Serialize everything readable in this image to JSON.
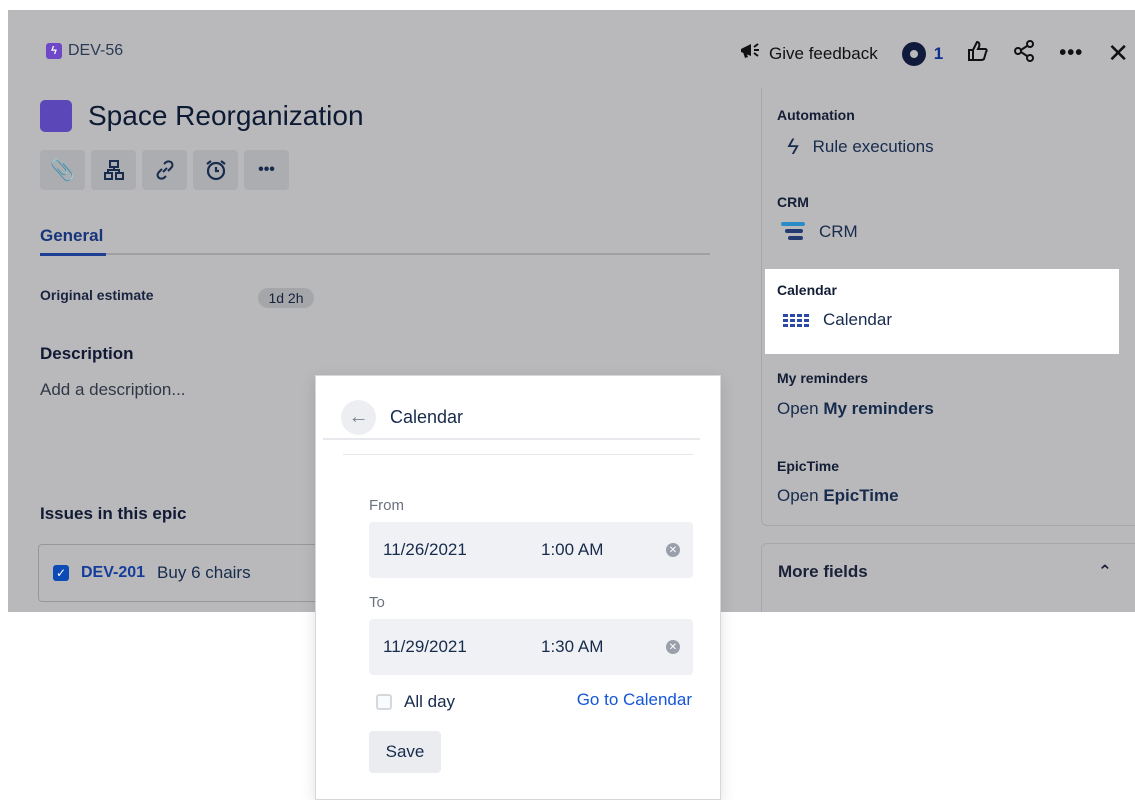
{
  "header": {
    "issue_key": "DEV-56",
    "feedback_label": "Give feedback",
    "watch_count": "1"
  },
  "issue": {
    "title": "Space Reorganization",
    "tab_general": "General",
    "original_estimate_label": "Original estimate",
    "original_estimate_value": "1d 2h",
    "description_title": "Description",
    "description_placeholder": "Add a description...",
    "issues_title": "Issues in this epic",
    "child_issues": [
      {
        "key": "DEV-201",
        "summary": "Buy 6 chairs"
      }
    ]
  },
  "sidebar": {
    "automation_label": "Automation",
    "automation_item": "Rule executions",
    "crm_label": "CRM",
    "crm_item": "CRM",
    "calendar_label": "Calendar",
    "calendar_item": "Calendar",
    "reminders_label": "My reminders",
    "reminders_prefix": "Open ",
    "reminders_strong": "My reminders",
    "epictime_label": "EpicTime",
    "epictime_prefix": "Open ",
    "epictime_strong": "EpicTime",
    "more_fields": "More fields"
  },
  "popup": {
    "title": "Calendar",
    "from_label": "From",
    "from_date": "11/26/2021",
    "from_time": "1:00 AM",
    "to_label": "To",
    "to_date": "11/29/2021",
    "to_time": "1:30 AM",
    "allday_label": "All day",
    "goto_label": "Go to Calendar",
    "save_label": "Save"
  },
  "colors": {
    "overlay": "#b9b9bb",
    "epic_purple": "#5b47b8",
    "link_blue": "#1557d6",
    "highlight": "#ffffff"
  }
}
